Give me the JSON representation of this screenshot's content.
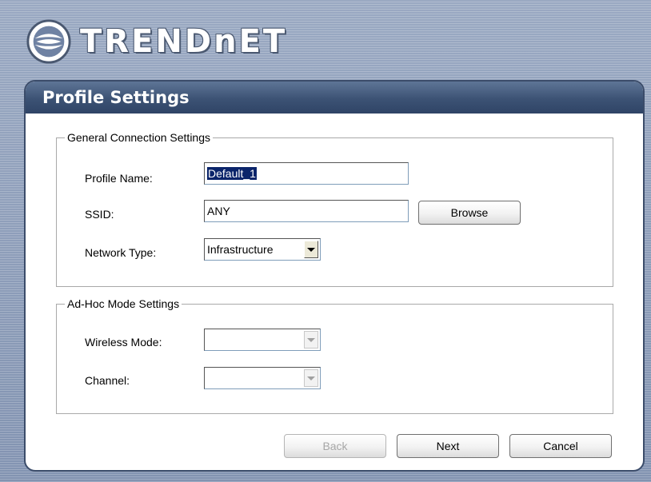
{
  "brand": {
    "name": "TRENDnET",
    "display": "TRENDnET"
  },
  "panel": {
    "title": "Profile Settings"
  },
  "general": {
    "legend": "General Connection Settings",
    "profile_name": {
      "label": "Profile Name:",
      "value": "Default_1"
    },
    "ssid": {
      "label": "SSID:",
      "value": "ANY",
      "browse_label": "Browse"
    },
    "network_type": {
      "label": "Network Type:",
      "value": "Infrastructure"
    }
  },
  "adhoc": {
    "legend": "Ad-Hoc Mode Settings",
    "wireless_mode": {
      "label": "Wireless Mode:",
      "value": ""
    },
    "channel": {
      "label": "Channel:",
      "value": ""
    }
  },
  "buttons": {
    "back": "Back",
    "next": "Next",
    "cancel": "Cancel"
  },
  "colors": {
    "header": "#3c5274",
    "background": "#8e9db6",
    "selection": "#0a246a"
  }
}
